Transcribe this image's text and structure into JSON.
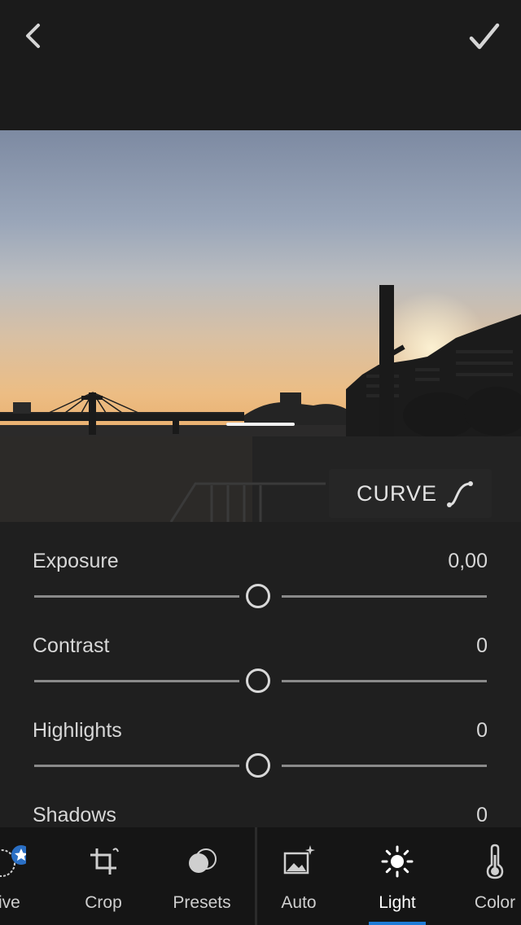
{
  "header": {
    "back_icon": "chevron-left-icon",
    "confirm_icon": "checkmark-icon"
  },
  "curve_button": {
    "label": "CURVE",
    "icon": "curve-icon"
  },
  "sliders": [
    {
      "label": "Exposure",
      "value": "0,00"
    },
    {
      "label": "Contrast",
      "value": "0"
    },
    {
      "label": "Highlights",
      "value": "0"
    },
    {
      "label": "Shadows",
      "value": "0"
    }
  ],
  "toolbar": {
    "tools": [
      {
        "label": "ective",
        "icon": "selective-icon"
      },
      {
        "label": "Crop",
        "icon": "crop-icon"
      },
      {
        "label": "Presets",
        "icon": "presets-icon"
      },
      {
        "label": "Auto",
        "icon": "auto-icon"
      },
      {
        "label": "Light",
        "icon": "light-icon",
        "active": true
      },
      {
        "label": "Color",
        "icon": "thermometer-icon"
      }
    ]
  },
  "colors": {
    "accent": "#1e7bd6",
    "background": "#1b1b1b",
    "panel": "#1f1f1f",
    "toolbar": "#151515"
  }
}
